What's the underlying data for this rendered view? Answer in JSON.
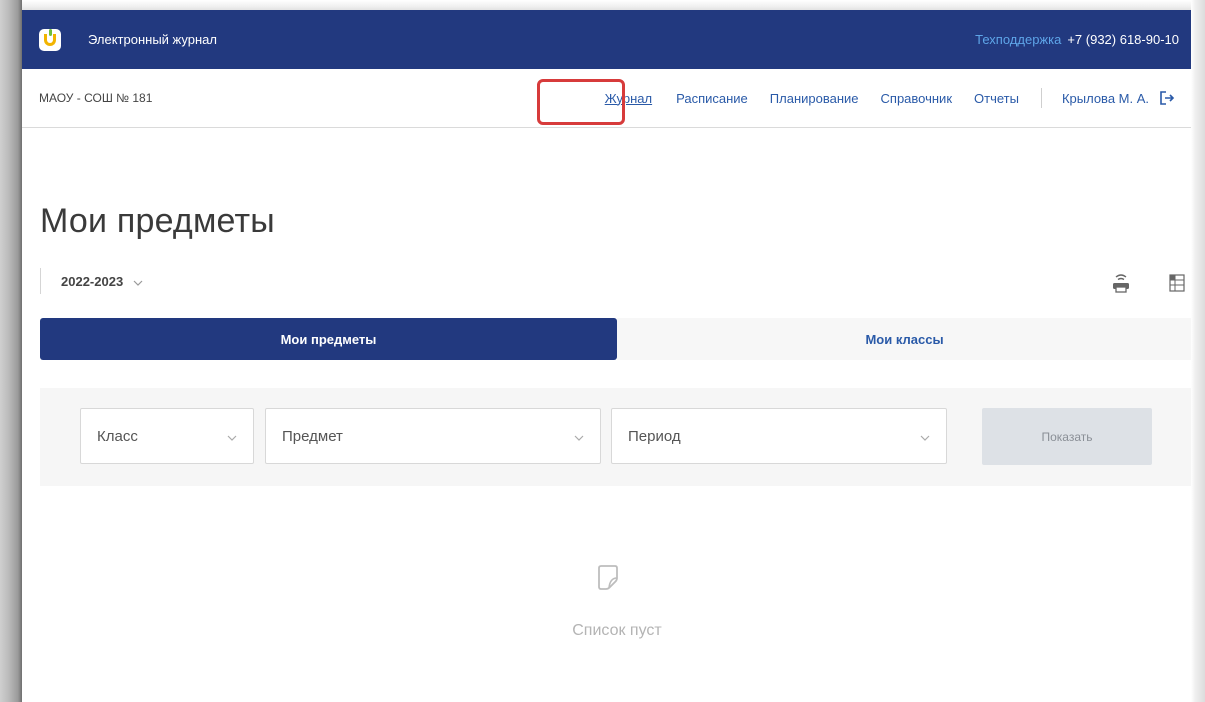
{
  "header": {
    "app_title": "Электронный журнал",
    "support_label": "Техподдержка",
    "support_phone": "+7 (932) 618-90-10"
  },
  "nav": {
    "school": "МАОУ - СОШ № 181",
    "items": [
      {
        "label": "Журнал",
        "active": true
      },
      {
        "label": "Расписание"
      },
      {
        "label": "Планирование"
      },
      {
        "label": "Справочник"
      },
      {
        "label": "Отчеты"
      }
    ],
    "user": "Крылова М. А."
  },
  "page": {
    "title": "Мои предметы",
    "year": "2022-2023"
  },
  "tabs": [
    {
      "label": "Мои предметы",
      "active": true
    },
    {
      "label": "Мои классы",
      "active": false
    }
  ],
  "filters": {
    "class_placeholder": "Класс",
    "subject_placeholder": "Предмет",
    "period_placeholder": "Период",
    "show_button": "Показать"
  },
  "empty_state": {
    "text": "Список пуст"
  },
  "colors": {
    "primary": "#22397f",
    "link": "#2a5aa8",
    "highlight": "#d73b3b"
  },
  "icons": [
    "logo-icon",
    "logout-icon",
    "chevron-down-icon",
    "print-icon",
    "excel-icon",
    "empty-list-icon"
  ]
}
